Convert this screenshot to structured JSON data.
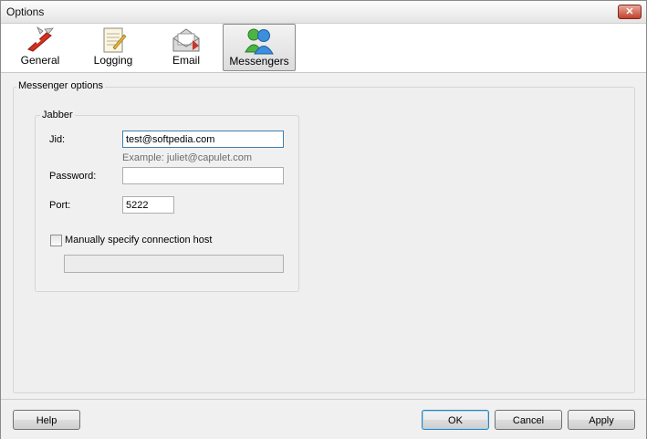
{
  "window": {
    "title": "Options",
    "close_glyph": "✕"
  },
  "toolbar": {
    "tabs": [
      {
        "label": "General",
        "icon": "swiss-knife-icon"
      },
      {
        "label": "Logging",
        "icon": "notepad-icon"
      },
      {
        "label": "Email",
        "icon": "envelope-icon"
      },
      {
        "label": "Messengers",
        "icon": "people-messenger-icon",
        "active": true
      }
    ]
  },
  "panel": {
    "title": "Messenger options",
    "jabber": {
      "title": "Jabber",
      "jid_label": "Jid:",
      "jid_value": "test@softpedia.com",
      "jid_example": "Example: juliet@capulet.com",
      "password_label": "Password:",
      "password_value": "",
      "port_label": "Port:",
      "port_value": "5222",
      "manual_host_label": "Manually specify connection host",
      "manual_host_checked": false,
      "connection_host_value": ""
    }
  },
  "footer": {
    "help": "Help",
    "ok": "OK",
    "cancel": "Cancel",
    "apply": "Apply"
  },
  "colors": {
    "focus_border": "#3c7fb1",
    "close_red": "#c2412c"
  }
}
